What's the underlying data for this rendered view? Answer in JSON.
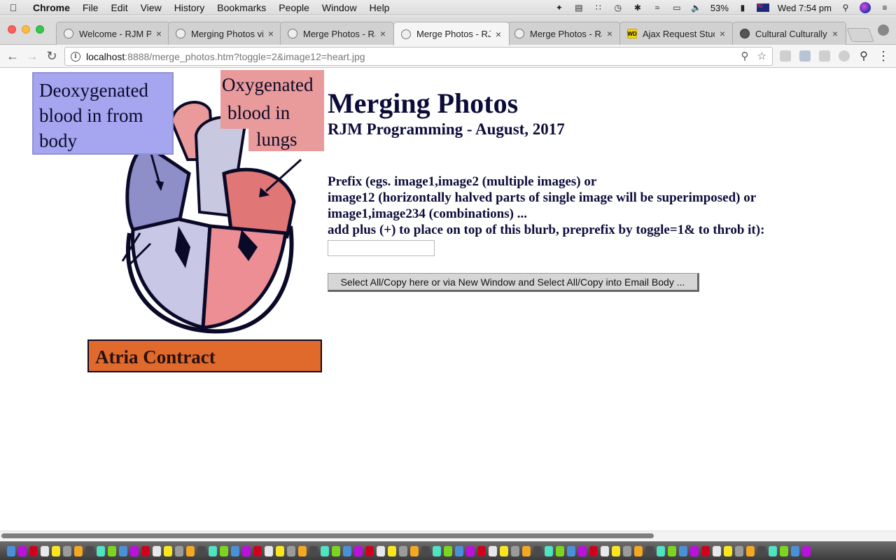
{
  "menubar": {
    "items": [
      "Chrome",
      "File",
      "Edit",
      "View",
      "History",
      "Bookmarks",
      "People",
      "Window",
      "Help"
    ],
    "battery": "53%",
    "clock": "Wed 7:54 pm"
  },
  "tabs": [
    {
      "label": "Welcome - RJM Pr",
      "icon": "globe-icon",
      "active": false
    },
    {
      "label": "Merging Photos vi",
      "icon": "globe-icon",
      "active": false
    },
    {
      "label": "Merge Photos - RJ",
      "icon": "globe-icon",
      "active": false
    },
    {
      "label": "Merge Photos - RJ",
      "icon": "globe-icon",
      "active": true
    },
    {
      "label": "Merge Photos - RJ",
      "icon": "globe-icon",
      "active": false
    },
    {
      "label": "Ajax Request Stuck",
      "icon": "wd-icon",
      "icon_text": "WD",
      "active": false
    },
    {
      "label": "Cultural Culturally",
      "icon": "globe-icon",
      "active": false
    }
  ],
  "address": {
    "host": "localhost",
    "path": ":8888/merge_photos.htm?toggle=2&image12=heart.jpg"
  },
  "figure": {
    "top_left_label": [
      "Deoxygenated",
      "blood in from",
      "body"
    ],
    "top_right_label": [
      "Oxygenated",
      "blood in",
      "lungs"
    ],
    "bottom_label": "Atria Contract",
    "colors": {
      "blue_label": "#a5a5f0",
      "red_label": "#e99a9a",
      "orange_label": "#e06a2c",
      "ventricle_blue": "#8e8ec8",
      "ventricle_red": "#ec8e94",
      "outline": "#0a0a28"
    }
  },
  "page": {
    "title": "Merging Photos",
    "subtitle": "RJM Programming - August, 2017",
    "instructions": [
      "Prefix (egs. image1,image2 (multiple images) or",
      "image12 (horizontally halved parts of single image will be superimposed) or",
      "image1,image234 (combinations) ...",
      "add plus (+) to place on top of this blurb, preprefix by toggle=1& to throb it):"
    ],
    "input_value": "",
    "button_label": "Select All/Copy here or via New Window and Select All/Copy into Email Body ..."
  },
  "scrollbar": {
    "horizontal_position": 0
  }
}
